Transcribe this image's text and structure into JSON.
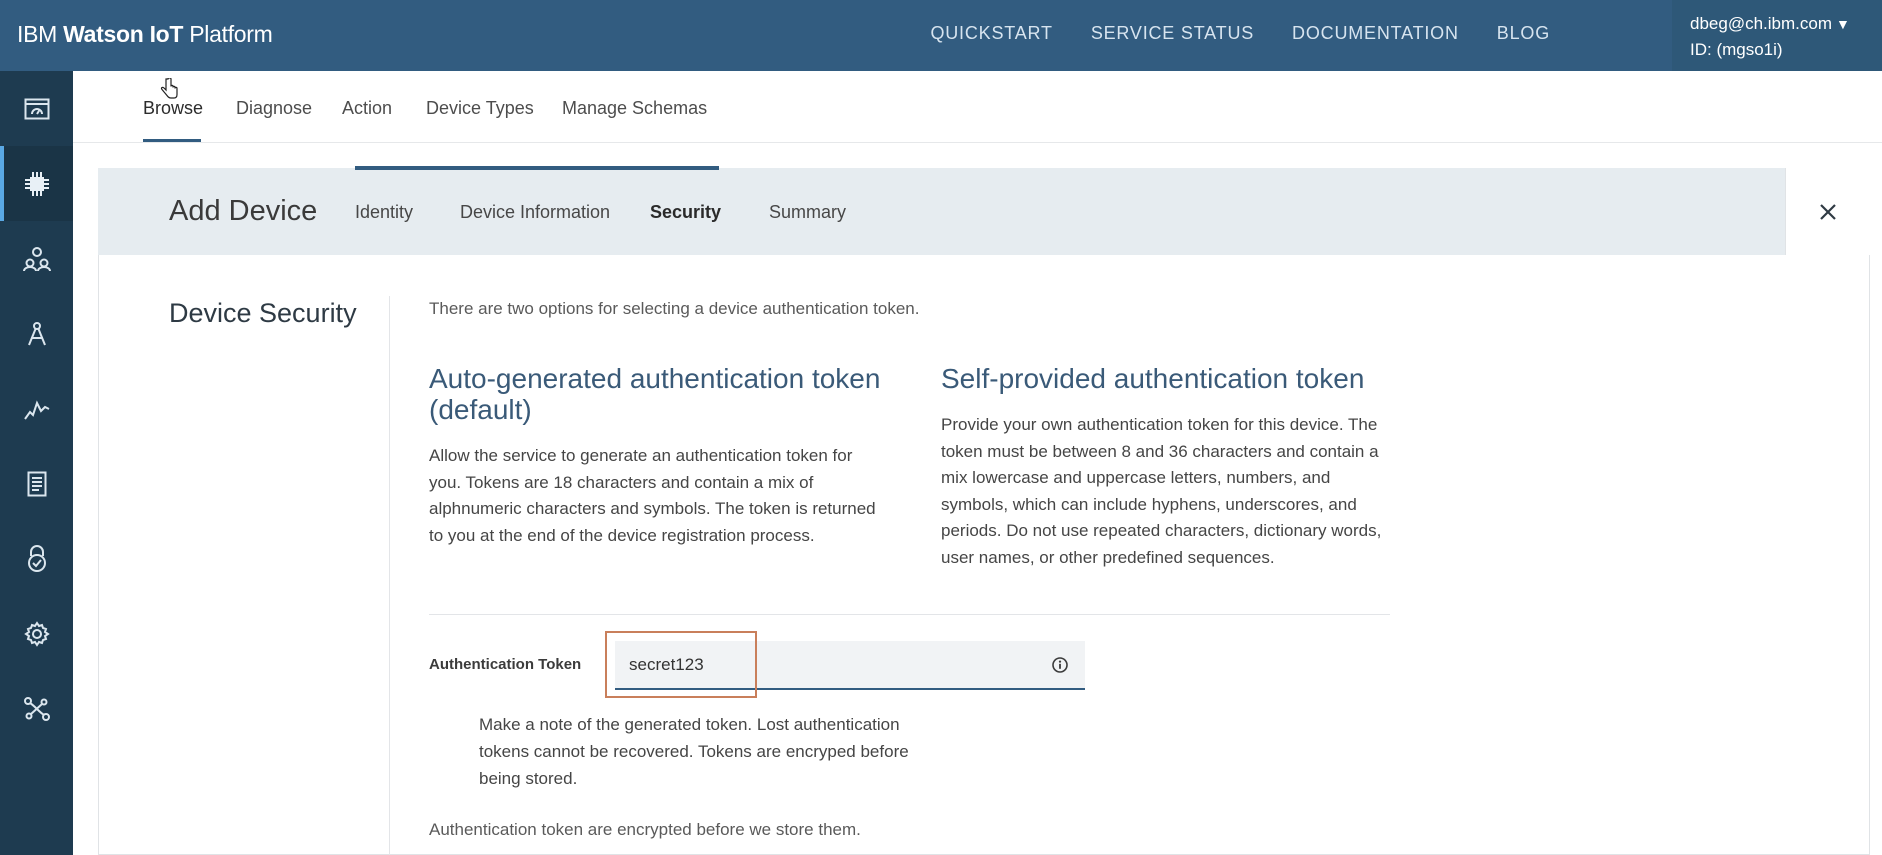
{
  "app": {
    "brand_prefix": "IBM ",
    "brand_bold": "Watson IoT",
    "brand_suffix": " Platform"
  },
  "topnav": [
    {
      "label": "QUICKSTART"
    },
    {
      "label": "SERVICE STATUS"
    },
    {
      "label": "DOCUMENTATION"
    },
    {
      "label": "BLOG"
    }
  ],
  "account": {
    "email": "dbeg@ch.ibm.com",
    "org_id": "ID: (mgso1i)",
    "caret": "▼"
  },
  "sidebar": {
    "items": [
      {
        "icon": "dashboard-icon"
      },
      {
        "icon": "devices-chip-icon",
        "active": true
      },
      {
        "icon": "members-icon"
      },
      {
        "icon": "apps-compass-icon"
      },
      {
        "icon": "usage-chart-icon"
      },
      {
        "icon": "rules-document-icon"
      },
      {
        "icon": "security-lock-icon"
      },
      {
        "icon": "settings-gear-icon"
      },
      {
        "icon": "extensions-icon"
      }
    ]
  },
  "subtabs": [
    {
      "label": "Browse",
      "active": true
    },
    {
      "label": "Diagnose"
    },
    {
      "label": "Action"
    },
    {
      "label": "Device Types"
    },
    {
      "label": "Manage Schemas"
    }
  ],
  "wizard": {
    "title": "Add Device",
    "steps": [
      {
        "label": "Identity"
      },
      {
        "label": "Device Information"
      },
      {
        "label": "Security",
        "current": true
      },
      {
        "label": "Summary"
      }
    ],
    "close": "✕"
  },
  "security": {
    "section_title": "Device Security",
    "intro": "There are two options for selecting a device authentication token.",
    "auto": {
      "title_line1": "Auto-generated authentication token",
      "title_line2": "(default)",
      "text": [
        "Allow the service to generate an authentication token for",
        "you. Tokens are 18 characters and contain a mix of",
        "alphnumeric characters and symbols. The token is returned",
        "to you at the end of the device registration process."
      ]
    },
    "self": {
      "title": "Self-provided authentication token",
      "text": [
        "Provide your own authentication token for this device. The",
        "token must be between 8 and 36 characters and contain a",
        "mix lowercase and uppercase letters, numbers, and",
        "symbols, which can include hyphens, underscores, and",
        "periods. Do not use repeated characters, dictionary words,",
        "user names, or other predefined sequences."
      ]
    },
    "token_label": "Authentication Token",
    "token_value": "secret123",
    "note": [
      "Make a note of the generated token. Lost authentication",
      "tokens cannot be recovered. Tokens are encryped before",
      "being stored."
    ],
    "footnote": "Authentication token are encrypted before we store them."
  },
  "colors": {
    "topbar": "#325c80",
    "sidebar": "#1e3b50",
    "accent": "#325c80",
    "highlight_box": "#c97f5b"
  }
}
